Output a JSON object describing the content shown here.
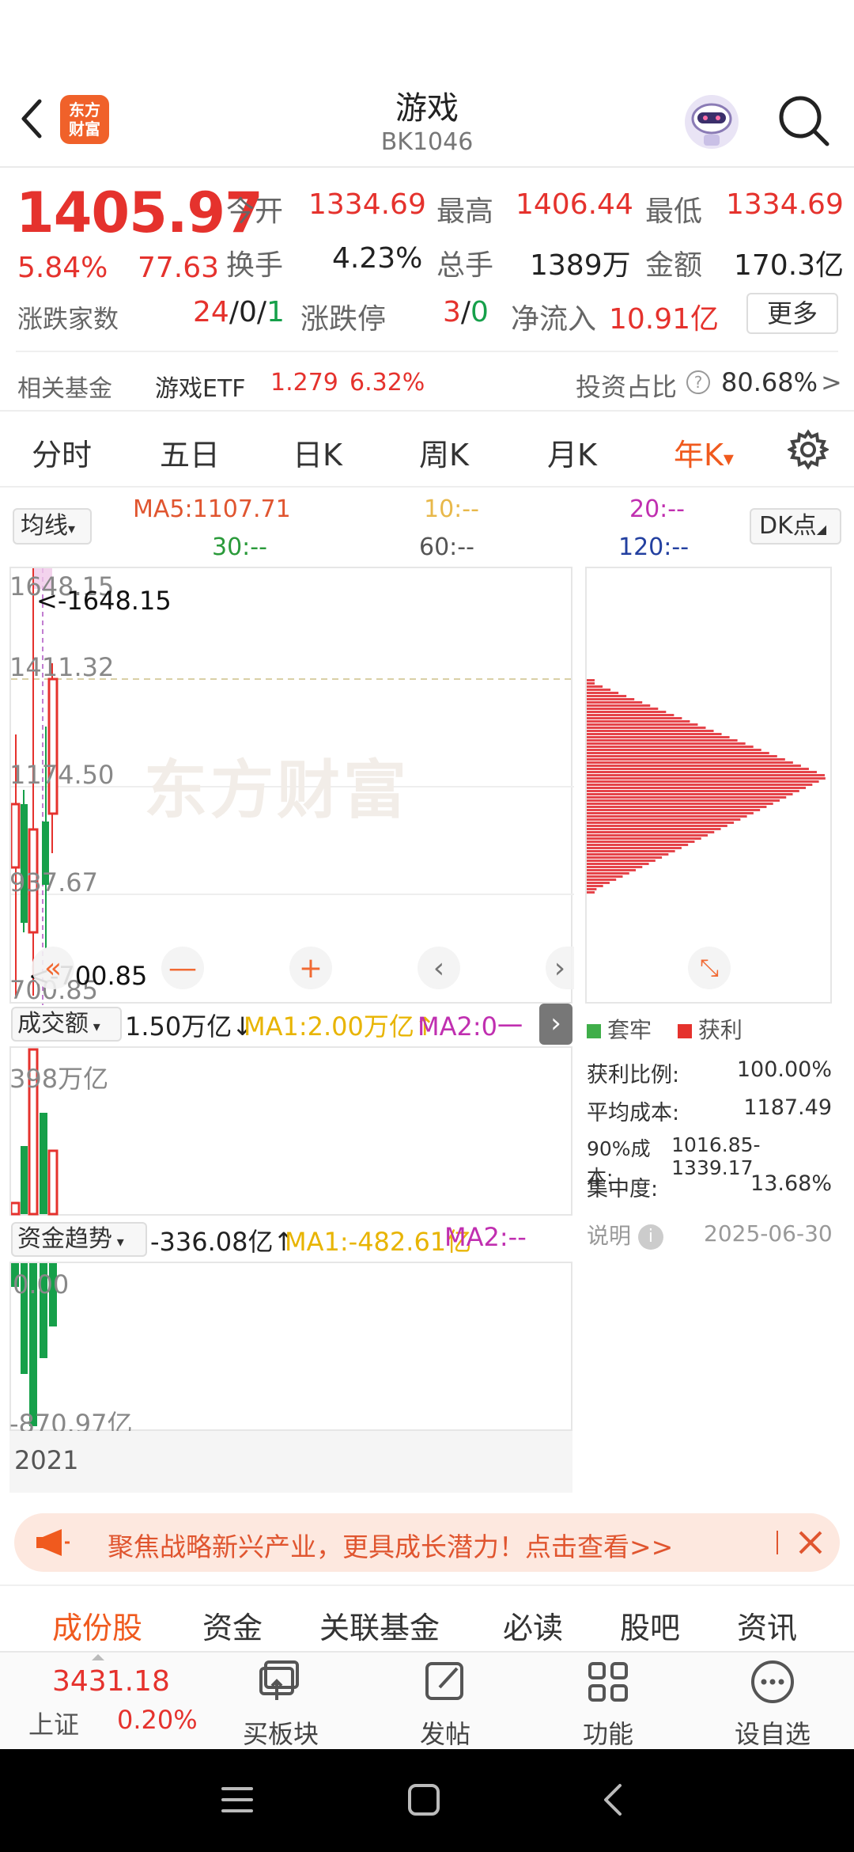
{
  "header": {
    "title": "游戏",
    "code": "BK1046",
    "logo_text_1": "东方",
    "logo_text_2": "财富"
  },
  "quote": {
    "price": "1405.97",
    "pct": "5.84%",
    "chg": "77.63",
    "open_label": "今开",
    "open": "1334.69",
    "high_label": "最高",
    "high": "1406.44",
    "low_label": "最低",
    "low": "1334.69",
    "turnover_label": "换手",
    "turnover": "4.23%",
    "vol_label": "总手",
    "vol": "1389万",
    "amt_label": "金额",
    "amt": "170.3亿",
    "updown_label": "涨跌家数",
    "up": "24",
    "flat": "/0/",
    "down": "1",
    "limit_label": "涨跌停",
    "limit_up": "3",
    "slash": "/",
    "limit_down": "0",
    "inflow_label": "净流入",
    "inflow": "10.91亿",
    "more": "更多"
  },
  "fund": {
    "label": "相关基金",
    "name": "游戏ETF",
    "price": "1.279",
    "pct": "6.32%",
    "ratio_label": "投资占比",
    "ratio": "80.68%",
    "arrow": ">"
  },
  "periods": {
    "tabs": [
      "分时",
      "五日",
      "日K",
      "周K",
      "月K",
      "年K"
    ],
    "active": "年K",
    "active_arrow": "▾"
  },
  "ma": {
    "selector": "均线",
    "ma5": "MA5:1107.71",
    "ma10": "10:--",
    "ma20": "20:--",
    "ma30": "30:--",
    "ma60": "60:--",
    "ma120": "120:--",
    "dk": "DK点"
  },
  "price_chart": {
    "top_label": "1648.15",
    "max_marker": "<-1648.15",
    "y_labels": [
      "1411.32",
      "1174.50",
      "937.67"
    ],
    "bottom_label": "700.85",
    "min_marker": "<-700.85",
    "watermark": "东方财富",
    "nav_minus": "—",
    "nav_plus": "+"
  },
  "volume": {
    "selector": "成交额",
    "value": "1.50万亿↓",
    "ma1": "MA1:2.00万亿↑",
    "ma2": "MA2:0一",
    "max_label": "398万亿"
  },
  "fund_flow": {
    "selector": "资金趋势",
    "value": "-336.08亿↑",
    "ma1": "MA1:-482.61亿",
    "ma2": "MA2:--",
    "top_label": "0.00",
    "bottom_label": "-870.97亿"
  },
  "x_axis": {
    "start": "2021"
  },
  "chip": {
    "legend_trapped": "套牢",
    "legend_profit": "获利",
    "rows": [
      {
        "k": "获利比例:",
        "v": "100.00%"
      },
      {
        "k": "平均成本:",
        "v": "1187.49"
      },
      {
        "k": "90%成本:",
        "v": "1016.85-1339.17"
      },
      {
        "k": "集中度:",
        "v": "13.68%"
      }
    ],
    "note": "说明",
    "date": "2025-06-30"
  },
  "banner": {
    "text": "聚焦战略新兴产业，更具成长潜力！点击查看>>"
  },
  "bottom_tabs": {
    "items": [
      "成份股",
      "资金",
      "关联基金",
      "必读",
      "股吧",
      "资讯"
    ],
    "active": "成份股"
  },
  "toolbar": {
    "index_value": "3431.18",
    "index_name": "上证",
    "index_pct": "0.20%",
    "buy_block": "买板块",
    "post": "发帖",
    "func": "功能",
    "watch": "设自选"
  },
  "colors": {
    "up": "#e5322d",
    "down": "#16a04a",
    "accent": "#f05a1e"
  },
  "chart_data": {
    "type": "candlestick",
    "x_start": "2021",
    "ylim": [
      700.85,
      1648.15
    ],
    "high": 1648.15,
    "low": 700.85,
    "last": 1405.97
  }
}
